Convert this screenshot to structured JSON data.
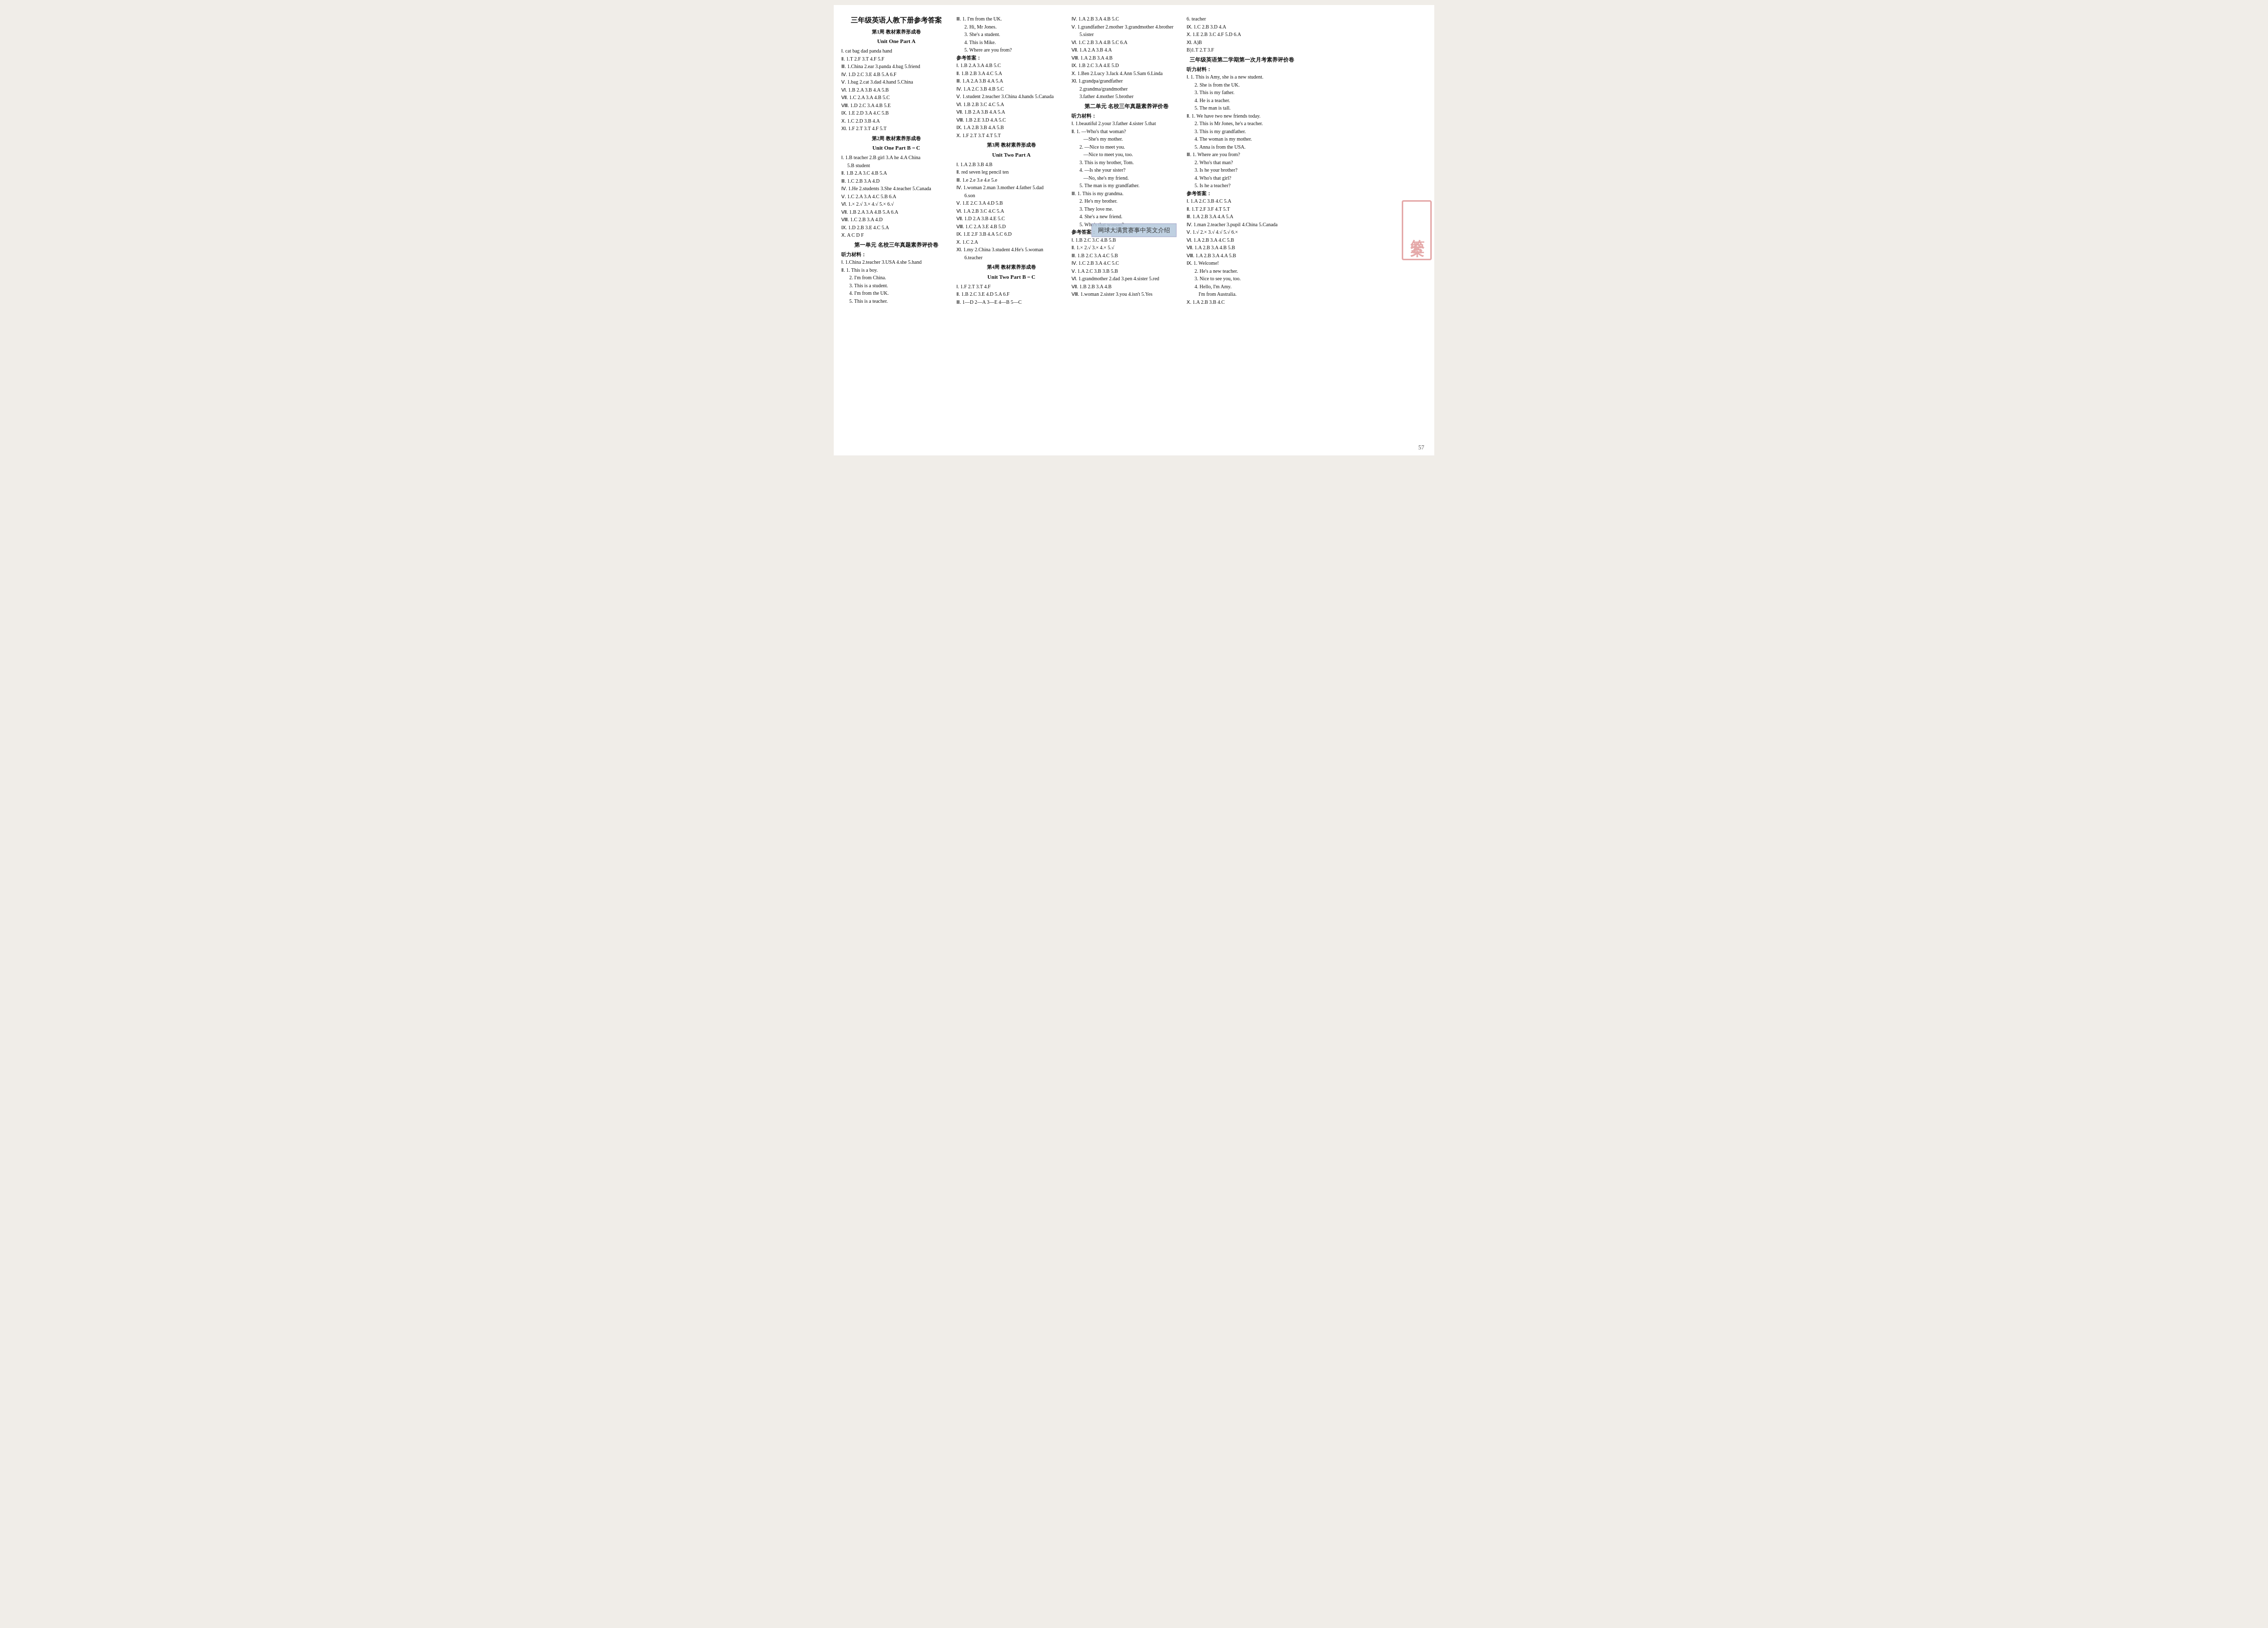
{
  "page": {
    "title": "三年级英语人教下册参考答案",
    "subtitle": "第1周 教材素养形成卷",
    "pageNum": "57",
    "stamp": "答案",
    "banner": "网球大满贯赛事中英文介绍"
  },
  "col1": {
    "mainTitle": "三年级英语人教下册参考答案",
    "week1": "第1周 教材素养形成卷",
    "unitOnePartA": "Unit One  Part A",
    "lines": [
      "Ⅰ. cat  bag  dad  panda  hand",
      "Ⅱ. 1.T  2.F  3.T  4.F  5.F",
      "Ⅲ. 1.China  2.ear  3.panda  4.bag  5.friend",
      "Ⅳ. 1.D  2.C  3.E  4.B  5.A  6.F",
      "Ⅴ. 1.bag  2.cat  3.dad  4.hand  5.China",
      "Ⅵ. 1.B  2.A  3.B  4.A  5.B",
      "Ⅶ. 1.C  2.A  3.A  4.B  5.C",
      "Ⅷ. 1.D  2.C  3.A  4.B  5.E",
      "Ⅸ. 1.E  2.D  3.A  4.C  5.B",
      "Ⅹ. 1.C  2.D  3.B  4.A",
      "Ⅺ. 1.F  2.T  3.T  4.F  5.T"
    ],
    "week2": "第2周 教材素养形成卷",
    "unitOnePartBC": "Unit One  Part B－C",
    "lines2": [
      "Ⅰ. 1.B  teacher  2.B  girl  3.A  he  4.A  China",
      "   5.B  student",
      "Ⅱ. 1.B  2.A  3.C  4.B  5.A",
      "Ⅲ. 1.C  2.B  3.A  4.D",
      "Ⅳ. 1.He  2.students  3.She  4.teacher  5.Canada",
      "Ⅴ. 1.C  2.A  3.A  4.C  5.B  6.A",
      "Ⅵ. 1.×  2.√  3.×  4.√  5.×  6.√",
      "Ⅶ. 1.B  2.A  3.A  4.B  5.A  6.A",
      "Ⅷ. 1.C  2.B  3.A  4.D",
      "Ⅸ. 1.D  2.B  3.E  4.C  5.A",
      "Ⅹ. A  C  D  F"
    ],
    "unitExam1": "第一单元  名校三年真题素养评价卷",
    "tingLiao": "听力材料：",
    "tingLines": [
      "Ⅰ. 1.China  2.teacher  3.USA  4.she  5.hand",
      "Ⅱ. 1. This is a boy.",
      "   2. I'm from China.",
      "   3. This is a student.",
      "   4. I'm from the UK.",
      "   5. This is a teacher."
    ]
  },
  "col2": {
    "lines": [
      "Ⅲ. 1. I'm from the UK.",
      "   2. Hi, Mr Jones.",
      "   3. She's a student.",
      "   4. This is Mike.",
      "   5. Where are you from?",
      "参考答案：",
      "Ⅰ. 1.B  2.A  3.A  4.B  5.C",
      "Ⅱ. 1.B  2.B  3.A  4.C  5.A",
      "Ⅲ. 1.A  2.A  3.B  4.A  5.A",
      "Ⅳ. 1.A  2.C  3.B  4.B  5.C",
      "Ⅴ. 1.student  2.teacher  3.China  4.hands  5.Canada",
      "Ⅵ. 1.B  2.B  3.C  4.C  5.A",
      "Ⅶ. 1.B  2.A  3.B  4.A  5.A",
      "Ⅷ. 1.B  2.E  3.D  4.A  5.C",
      "Ⅸ. 1.A  2.B  3.B  4.A  5.B",
      "Ⅹ. 1.F  2.T  3.T  4.T  5.T"
    ],
    "week3": "第3周 教材素养形成卷",
    "unitTwoPartA": "Unit Two  Part A",
    "lines2": [
      "Ⅰ. 1.A  2.B  3.B  4.B",
      "Ⅱ. red  seven  leg  pencil  ten",
      "Ⅲ. 1.e  2.e  3.e  4.e  5.e",
      "Ⅳ. 1.woman  2.man  3.mother  4.father  5.dad",
      "   6.son",
      "Ⅴ. 1.E  2.C  3.A  4.D  5.B",
      "Ⅵ. 1.A  2.B  3.C  4.C  5.A",
      "Ⅶ. 1.D  2.A  3.B  4.E  5.C",
      "Ⅷ. 1.C  2.A  3.E  4.B  5.D",
      "Ⅸ. 1.E  2.F  3.B  4.A  5.C  6.D",
      "Ⅹ. 1.C  2.A",
      "Ⅺ. 1.my  2.China  3.student  4.He's  5.woman",
      "   6.teacher"
    ],
    "week4": "第4周 教材素养形成卷",
    "unitTwoPartBC": "Unit Two  Part B－C",
    "lines3": [
      "Ⅰ. 1.F  2.T  3.T  4.F",
      "Ⅱ. 1.B  2.C  3.E  4.D  5.A  6.F",
      "Ⅲ. 1—D  2—A  3—E  4—B  5—C"
    ]
  },
  "col3": {
    "lines": [
      "Ⅳ. 1.A  2.B  3.A  4.B  5.C",
      "Ⅴ. 1.grandfather  2.mother  3.grandmother  4.brother",
      "   5.sister",
      "Ⅵ. 1.C  2.B  3.A  4.B  5.C  6.A",
      "Ⅶ. 1.A  2.A  3.B  4.A",
      "Ⅷ. 1.A  2.B  3.A  4.B",
      "Ⅸ. 1.B  2.C  3.A  4.E  5.D",
      "Ⅹ. 1.Ben  2.Lucy  3.Jack  4.Ann  5.Sam  6.Linda",
      "Ⅺ. 1.grandpa/grandfather",
      "   2.grandma/grandmother",
      "   3.father  4.mother  5.brother"
    ],
    "unitExam2": "第二单元  名校三年真题素养评价卷",
    "tingLiao": "听力材料：",
    "tingLines": [
      "Ⅰ. 1.beautiful  2.your  3.father  4.sister  5.that",
      "Ⅱ. 1. —Who's that woman?",
      "      —She's my mother.",
      "   2. —Nice to meet you.",
      "      —Nice to meet you, too.",
      "   3. This is my brother, Tom.",
      "   4. —Is she your sister?",
      "      —No, she's my friend.",
      "   5. The man is my grandfather.",
      "Ⅲ. 1. This is my grandma.",
      "   2. He's my brother.",
      "   3. They love me.",
      "   4. She's a new friend.",
      "   5. Who's that woman?"
    ],
    "canKao": "参考答案：",
    "canKaoLines": [
      "Ⅰ. 1.B  2.C  3.C  4.B  5.B",
      "Ⅱ. 1.×  2.√  3.×  4.×  5.√",
      "Ⅲ. 1.B  2.C  3.A  4.C  5.B",
      "Ⅳ. 1.C  2.B  3.A  4.C  5.C",
      "Ⅴ. 1.A  2.C  3.B  3.B  5.B",
      "Ⅵ. 1.grandmother  2.dad  3.pen  4.sister  5.red",
      "Ⅶ. 1.B  2.B  3.A  4.B",
      "Ⅷ. 1.woman  2.sister  3.you  4.isn't  5.Yes"
    ]
  },
  "col4": {
    "lines": [
      "6. teacher",
      "Ⅸ. 1.C  2.B  3.D  4.A",
      "Ⅹ. 1.E  2.B  3.C  4.F  5.D  6.A",
      "Ⅺ. A)B"
    ],
    "monthExam": "B)1.T  2.T  3.F",
    "monthTitle": "三年级英语第二学期第一次月考素养评价卷",
    "tingLiao": "听力材料：",
    "tingLines": [
      "Ⅰ. 1. This is Amy, she is a new student.",
      "   2. She is from the UK.",
      "   3. This is my father.",
      "   4. He is a teacher.",
      "   5. The man is tall.",
      "Ⅱ. 1. We have two new friends today.",
      "   2. This is Mr Jones, he's a teacher.",
      "   3. This is my grandfather.",
      "   4. The woman is my mother.",
      "   5. Anna is from the USA.",
      "Ⅲ. 1. Where are you from?",
      "   2. Who's that man?",
      "   3. Is he your brother?",
      "   4. Who's that girl?",
      "   5. Is he a teacher?"
    ],
    "canKao": "参考答案：",
    "canKaoLines": [
      "Ⅰ. 1.A  2.C  3.B  4.C  5.A",
      "Ⅱ. 1.T  2.F  3.F  4.T  5.T",
      "Ⅲ. 1.A  2.B  3.A  4.A  5.A",
      "Ⅳ. 1.man  2.teacher  3.pupil  4.China  5.Canada",
      "Ⅴ. 1.√  2.×  3.√  4.√  5.√  6.×",
      "Ⅵ. 1.A  2.B  3.A  4.C  5.B",
      "Ⅶ. 1.A  2.B  3.A  4.B  5.B",
      "Ⅷ. 1.A  2.B  3.A  4.A  5.B",
      "Ⅸ. 1. Welcome!",
      "   2. He's a new teacher.",
      "   3. Nice to see you, too.",
      "   4. Hello, I'm Amy.",
      "      I'm from Australia.",
      "Ⅹ. 1.A  2.B  3.B  4.C"
    ]
  }
}
